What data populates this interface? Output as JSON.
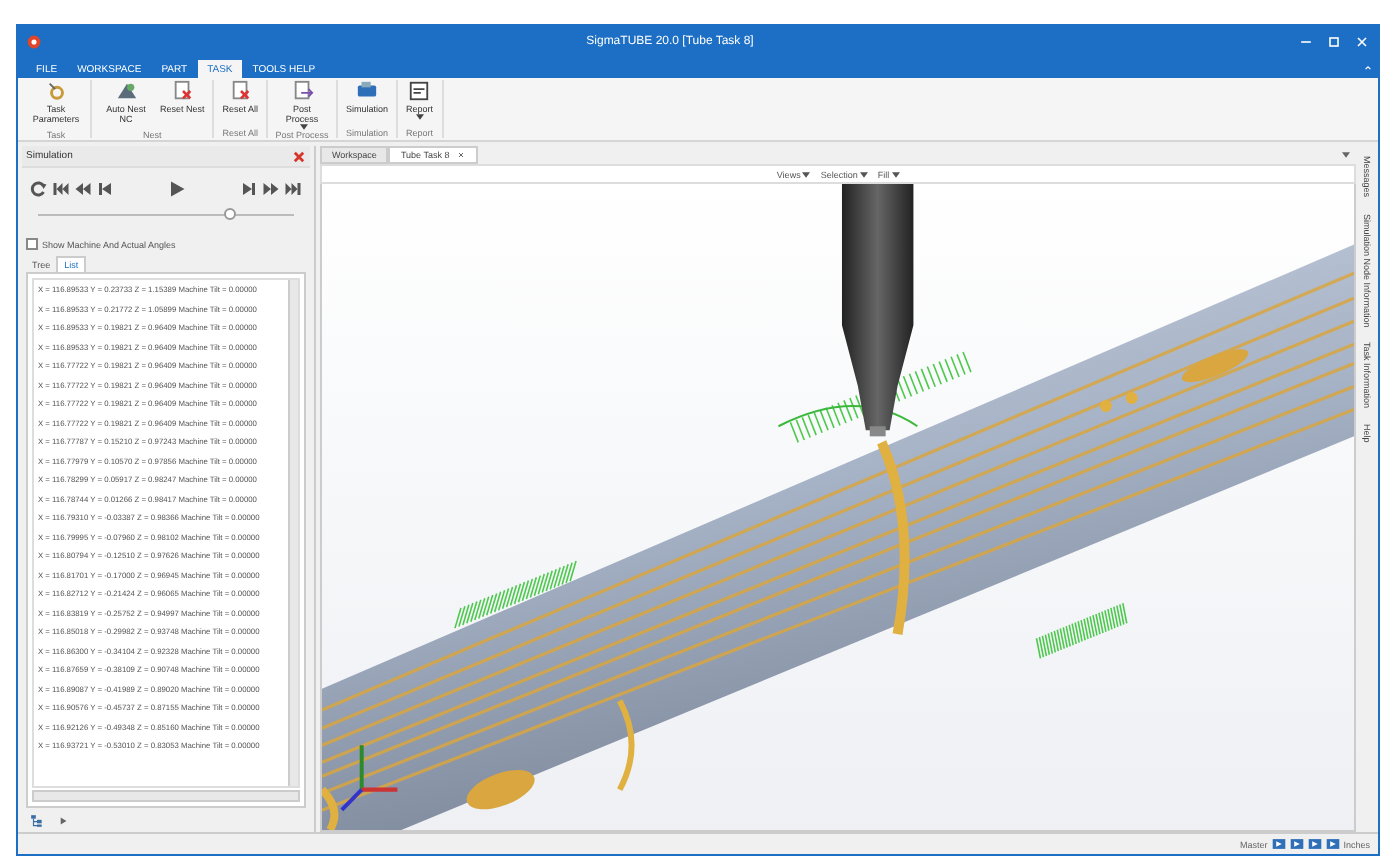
{
  "window": {
    "title": "SigmaTUBE 20.0 [Tube Task 8]"
  },
  "menu_tabs": [
    {
      "label": "FILE",
      "selected": false
    },
    {
      "label": "WORKSPACE",
      "selected": false
    },
    {
      "label": "PART",
      "selected": false
    },
    {
      "label": "TASK",
      "selected": true
    },
    {
      "label": "TOOLS HELP",
      "selected": false
    }
  ],
  "ribbon_groups": [
    {
      "label": "Task",
      "buttons": [
        {
          "label": "Task Parameters",
          "kind": "params",
          "dropdown": false
        }
      ]
    },
    {
      "label": "Nest",
      "buttons": [
        {
          "label": "Auto Nest NC",
          "kind": "nest",
          "dropdown": false
        },
        {
          "label": "Reset Nest",
          "kind": "reset",
          "dropdown": false
        }
      ]
    },
    {
      "label": "Reset All",
      "buttons": [
        {
          "label": "Reset All",
          "kind": "reset",
          "dropdown": false
        }
      ]
    },
    {
      "label": "Post Process",
      "buttons": [
        {
          "label": "Post Process",
          "kind": "post",
          "dropdown": true
        }
      ]
    },
    {
      "label": "Simulation",
      "buttons": [
        {
          "label": "Simulation",
          "kind": "sim",
          "dropdown": false
        }
      ]
    },
    {
      "label": "Report",
      "buttons": [
        {
          "label": "Report",
          "kind": "report",
          "dropdown": true
        }
      ]
    }
  ],
  "simulation_panel": {
    "title": "Simulation",
    "slider": {
      "level": 0.75
    },
    "show_angles": {
      "label": "Show Machine And Actual Angles",
      "checked": false
    },
    "tabs": [
      {
        "label": "Tree",
        "selected": false
      },
      {
        "label": "List",
        "selected": true
      }
    ],
    "rows": [
      "X = 116.89533  Y = 0.23733  Z = 1.15389 Machine Tilt = 0.00000",
      "X = 116.89533  Y = 0.21772  Z = 1.05899 Machine Tilt = 0.00000",
      "X = 116.89533  Y = 0.19821  Z = 0.96409 Machine Tilt = 0.00000",
      "X = 116.89533  Y = 0.19821  Z = 0.96409 Machine Tilt = 0.00000",
      "X = 116.77722  Y = 0.19821  Z = 0.96409 Machine Tilt = 0.00000",
      "X = 116.77722  Y = 0.19821  Z = 0.96409 Machine Tilt = 0.00000",
      "X = 116.77722  Y = 0.19821  Z = 0.96409 Machine Tilt = 0.00000",
      "X = 116.77722  Y = 0.19821  Z = 0.96409 Machine Tilt = 0.00000",
      "X = 116.77787  Y = 0.15210  Z = 0.97243 Machine Tilt = 0.00000",
      "X = 116.77979  Y = 0.10570  Z = 0.97856 Machine Tilt = 0.00000",
      "X = 116.78299  Y = 0.05917  Z = 0.98247 Machine Tilt = 0.00000",
      "X = 116.78744  Y = 0.01266  Z = 0.98417 Machine Tilt = 0.00000",
      "X = 116.79310  Y = -0.03387  Z = 0.98366 Machine Tilt = 0.00000",
      "X = 116.79995  Y = -0.07960  Z = 0.98102 Machine Tilt = 0.00000",
      "X = 116.80794  Y = -0.12510  Z = 0.97626 Machine Tilt = 0.00000",
      "X = 116.81701  Y = -0.17000  Z = 0.96945 Machine Tilt = 0.00000",
      "X = 116.82712  Y = -0.21424  Z = 0.96065 Machine Tilt = 0.00000",
      "X = 116.83819  Y = -0.25752  Z = 0.94997 Machine Tilt = 0.00000",
      "X = 116.85018  Y = -0.29982  Z = 0.93748 Machine Tilt = 0.00000",
      "X = 116.86300  Y = -0.34104  Z = 0.92328 Machine Tilt = 0.00000",
      "X = 116.87659  Y = -0.38109  Z = 0.90748 Machine Tilt = 0.00000",
      "X = 116.89087  Y = -0.41989  Z = 0.89020 Machine Tilt = 0.00000",
      "X = 116.90576  Y = -0.45737  Z = 0.87155 Machine Tilt = 0.00000",
      "X = 116.92126  Y = -0.49348  Z = 0.85160 Machine Tilt = 0.00000",
      "X = 116.93721  Y = -0.53010  Z = 0.83053 Machine Tilt = 0.00000"
    ]
  },
  "document_tabs": [
    {
      "label": "Workspace",
      "selected": false,
      "closable": false
    },
    {
      "label": "Tube Task 8",
      "selected": true,
      "closable": true
    }
  ],
  "view_toolbar": [
    "Views",
    "Selection",
    "Fill"
  ],
  "side_tabs": [
    "Messages",
    "Simulation Node Information",
    "Task Information",
    "Help"
  ],
  "status_bar": {
    "mode": "Master",
    "units": "Inches"
  }
}
